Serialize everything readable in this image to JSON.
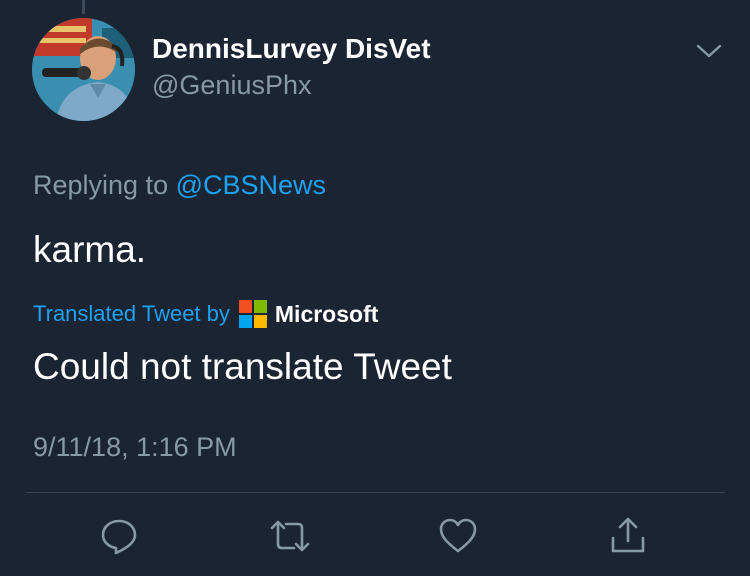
{
  "tweet": {
    "display_name": "DennisLurvey DisVet",
    "handle": "@GeniusPhx",
    "replying_prefix": "Replying to ",
    "replying_to": "@CBSNews",
    "text": "karma.",
    "translation": {
      "label": "Translated Tweet by",
      "provider": "Microsoft",
      "result": "Could not translate Tweet"
    },
    "timestamp": "9/11/18, 1:16 PM"
  },
  "icons": {
    "menu": "chevron-down-icon",
    "reply": "reply-icon",
    "retweet": "retweet-icon",
    "like": "heart-icon",
    "share": "share-icon"
  },
  "colors": {
    "background": "#1b2433",
    "link": "#1da1f2",
    "secondary_text": "#8899a6",
    "microsoft_red": "#f25022",
    "microsoft_green": "#7fba00",
    "microsoft_blue": "#00a4ef",
    "microsoft_yellow": "#ffb900"
  }
}
